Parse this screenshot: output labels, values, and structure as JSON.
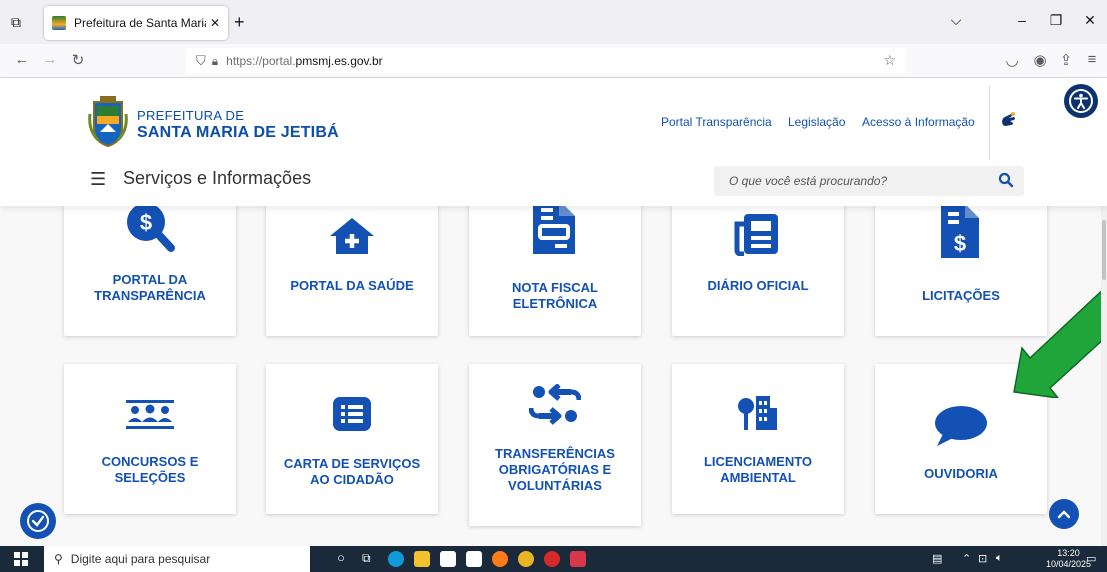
{
  "browser": {
    "tab_title": "Prefeitura de Santa Maria de Jet",
    "new_tab_icon": "plus-icon",
    "url_prefix": "https://portal.",
    "url_host": "pmsmj.es.gov.br",
    "url_suffix": ""
  },
  "header": {
    "brand_line1": "PREFEITURA DE",
    "brand_line2": "SANTA MARIA DE JETIBÁ",
    "top_links": [
      "Portal Transparência",
      "Legislação",
      "Acesso à Informação"
    ],
    "menu_title": "Serviços e Informações",
    "search_placeholder": "O que você está procurando?"
  },
  "services": [
    {
      "label": "PORTAL DA TRANSPARÊNCIA",
      "lines": [
        "PORTAL DA",
        "TRANSPARÊNCIA"
      ],
      "icon": "dollar-search-icon"
    },
    {
      "label": "PORTAL DA SAÚDE",
      "lines": [
        "PORTAL DA SAÚDE"
      ],
      "icon": "health-house-icon"
    },
    {
      "label": "NOTA FISCAL ELETRÔNICA",
      "lines": [
        "NOTA FISCAL",
        "ELETRÔNICA"
      ],
      "icon": "invoice-icon"
    },
    {
      "label": "DIÁRIO OFICIAL",
      "lines": [
        "DIÁRIO OFICIAL"
      ],
      "icon": "newspaper-icon"
    },
    {
      "label": "LICITAÇÕES",
      "lines": [
        "LICITAÇÕES"
      ],
      "icon": "dollar-document-icon"
    },
    {
      "label": "CONCURSOS E SELEÇÕES",
      "lines": [
        "CONCURSOS E",
        "SELEÇÕES"
      ],
      "icon": "people-icon"
    },
    {
      "label": "CARTA DE SERVIÇOS AO CIDADÃO",
      "lines": [
        "CARTA DE SERVIÇOS",
        "AO CIDADÃO"
      ],
      "icon": "list-icon"
    },
    {
      "label": "TRANSFERÊNCIAS OBRIGATÓRIAS E VOLUNTÁRIAS",
      "lines": [
        "TRANSFERÊNCIAS",
        "OBRIGATÓRIAS E",
        "VOLUNTÁRIAS"
      ],
      "icon": "transfer-arrows-icon"
    },
    {
      "label": "LICENCIAMENTO AMBIENTAL",
      "lines": [
        "LICENCIAMENTO",
        "AMBIENTAL"
      ],
      "icon": "tree-building-icon"
    },
    {
      "label": "OUVIDORIA",
      "lines": [
        "OUVIDORIA"
      ],
      "icon": "speech-bubble-icon"
    }
  ],
  "taskbar": {
    "search_placeholder": "Digite aqui para pesquisar",
    "time": "13:20",
    "date": "10/04/2025"
  },
  "colors": {
    "brand_blue": "#1351b4",
    "dark_blue": "#0c326f",
    "arrow_green": "#1fa53a"
  }
}
